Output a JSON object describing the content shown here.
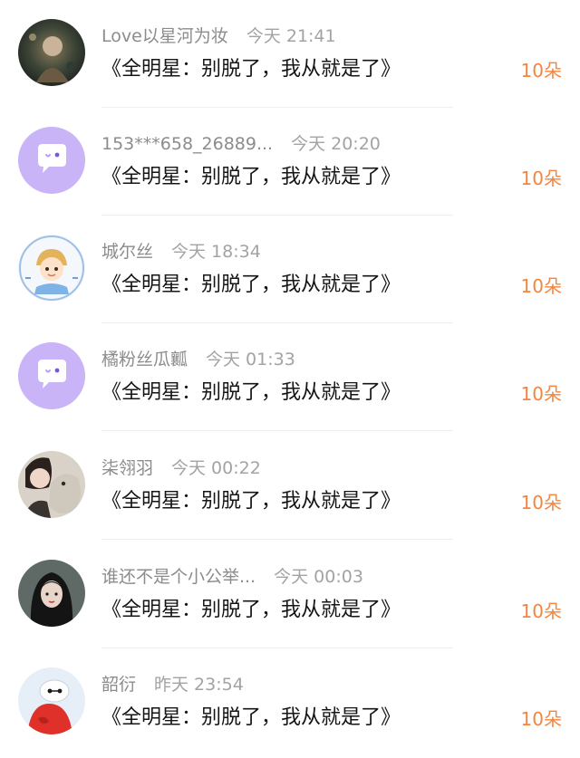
{
  "colors": {
    "gift_accent": "#f5853d",
    "default_avatar_bg": "#c8b4f6"
  },
  "comments": [
    {
      "name": "Love以星河为妆",
      "time": "今天 21:41",
      "text": "《全明星：别脱了，我从就是了》",
      "gift": "10朵",
      "avatar_icon": "art-avatar-icon"
    },
    {
      "name": "153***658_26889...",
      "time": "今天 20:20",
      "text": "《全明星：别脱了，我从就是了》",
      "gift": "10朵",
      "avatar_icon": "default-chat-bubble-avatar-icon"
    },
    {
      "name": "城尔丝",
      "time": "今天 18:34",
      "text": "《全明星：别脱了，我从就是了》",
      "gift": "10朵",
      "avatar_icon": "cartoon-boy-avatar-icon"
    },
    {
      "name": "橘粉丝瓜瓤",
      "time": "今天 01:33",
      "text": "《全明星：别脱了，我从就是了》",
      "gift": "10朵",
      "avatar_icon": "default-chat-bubble-avatar-icon"
    },
    {
      "name": "柒翎羽",
      "time": "今天 00:22",
      "text": "《全明星：别脱了，我从就是了》",
      "gift": "10朵",
      "avatar_icon": "girl-with-plush-avatar-icon"
    },
    {
      "name": "谁还不是个小公举...",
      "time": "今天 00:03",
      "text": "《全明星：别脱了，我从就是了》",
      "gift": "10朵",
      "avatar_icon": "illustrated-girl-avatar-icon"
    },
    {
      "name": "韶衍",
      "time": "昨天 23:54",
      "text": "《全明星：别脱了，我从就是了》",
      "gift": "10朵",
      "avatar_icon": "robot-avatar-icon"
    }
  ]
}
